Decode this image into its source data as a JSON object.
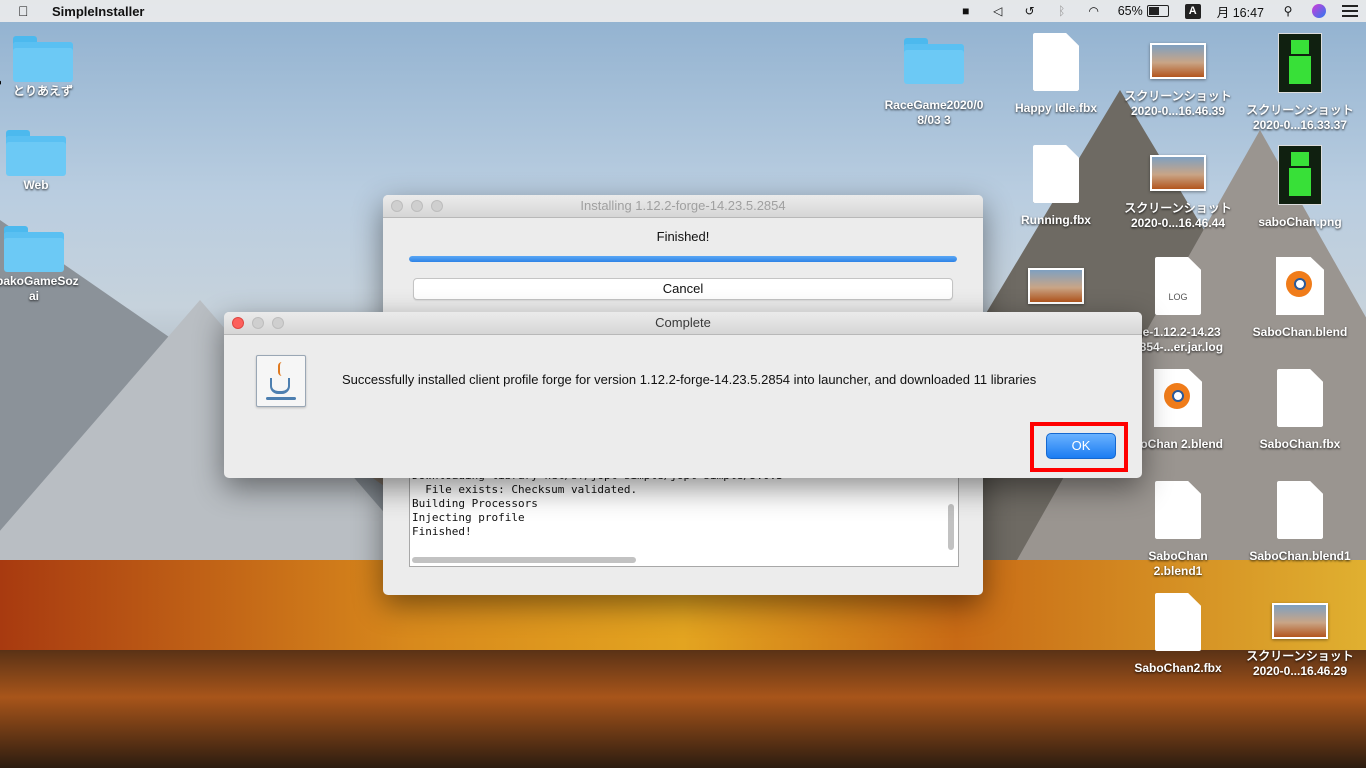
{
  "menubar": {
    "app_name": "SimpleInstaller",
    "battery_percent": "65%",
    "battery_level": 0.65,
    "input_source": "A",
    "datetime": "月 16:47",
    "icons": [
      "apple-icon",
      "facetime-icon",
      "unity-icon",
      "time-machine-icon",
      "bluetooth-icon",
      "wifi-icon",
      "battery-icon",
      "input-source-icon",
      "search-icon",
      "siri-icon",
      "notification-center-icon"
    ]
  },
  "desktop_left": [
    {
      "label": "とりあえず",
      "kind": "folder-alias"
    },
    {
      "label": "Web",
      "kind": "folder"
    },
    {
      "label": "abakoGameSoz\nai",
      "kind": "folder"
    }
  ],
  "desktop_right": [
    {
      "label": "RaceGame2020/0\n8/03 3",
      "kind": "folder"
    },
    {
      "label": "Happy Idle.fbx",
      "kind": "doc"
    },
    {
      "label": "スクリーンショット\n2020-0...16.46.39",
      "kind": "screenshot"
    },
    {
      "label": "スクリーンショット\n2020-0...16.33.37",
      "kind": "green"
    },
    {
      "label": "Running.fbx",
      "kind": "doc"
    },
    {
      "label": "スクリーンショット\n2020-0...16.46.44",
      "kind": "screenshot"
    },
    {
      "label": "saboChan.png",
      "kind": "green"
    },
    {
      "label": "",
      "kind": "screenshot"
    },
    {
      "label": "ge-1.12.2-14.23\n2854-...er.jar.log",
      "kind": "log",
      "ext": "LOG"
    },
    {
      "label": "SaboChan.blend",
      "kind": "blender"
    },
    {
      "label": "boChan 2.blend",
      "kind": "blender"
    },
    {
      "label": "SaboChan.fbx",
      "kind": "doc"
    },
    {
      "label": "SaboChan\n2.blend1",
      "kind": "doc"
    },
    {
      "label": "SaboChan.blend1",
      "kind": "doc"
    },
    {
      "label": "SaboChan2.fbx",
      "kind": "doc"
    },
    {
      "label": "スクリーンショット\n2020-0...16.46.29",
      "kind": "screenshot"
    }
  ],
  "installer": {
    "title": "Installing 1.12.2-forge-14.23.5.2854",
    "status": "Finished!",
    "progress": 1.0,
    "cancel_label": "Cancel",
    "log_lines": [
      "Downloading library net/sf/jopt-simple/jopt-simple/5.0.3",
      "  File exists: Checksum validated.",
      "Building Processors",
      "Injecting profile",
      "Finished!"
    ]
  },
  "dialog": {
    "title": "Complete",
    "message": "Successfully installed client profile forge for version 1.12.2-forge-14.23.5.2854 into launcher, and downloaded 11 libraries",
    "ok_label": "OK"
  },
  "colors": {
    "highlight": "#ff0000",
    "ok_button": "#1b7cf2",
    "progress": "#2e83e6"
  }
}
